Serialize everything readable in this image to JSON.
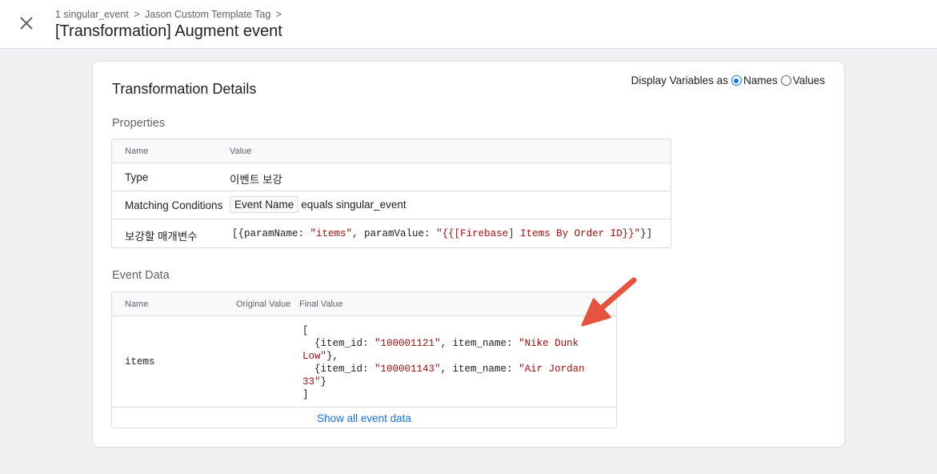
{
  "header": {
    "breadcrumb": [
      "1 singular_event",
      "Jason Custom Template Tag"
    ],
    "breadcrumb_separator": ">",
    "title": "[Transformation] Augment event"
  },
  "card": {
    "title": "Transformation Details",
    "display_vars": {
      "label": "Display Variables as",
      "options": [
        "Names",
        "Values"
      ],
      "selected": "Names"
    }
  },
  "properties": {
    "section_title": "Properties",
    "headers": {
      "name": "Name",
      "value": "Value"
    },
    "type": {
      "name": "Type",
      "value": "이벤트 보강"
    },
    "matching": {
      "name": "Matching Conditions",
      "chip": "Event Name",
      "rest": "equals singular_event"
    },
    "augment": {
      "name": "보강할 매개변수",
      "prefix": "[{paramName: ",
      "param_name": "\"items\"",
      "middle": ", paramValue: ",
      "param_value": "\"{{[Firebase] Items By Order ID}}\"",
      "suffix": "}]"
    }
  },
  "event_data": {
    "section_title": "Event Data",
    "headers": {
      "name": "Name",
      "original": "Original Value",
      "final": "Final Value"
    },
    "row": {
      "name": "items",
      "original": "",
      "line1": "[",
      "line2_a": "  {item_id: ",
      "line2_id": "\"100001121\"",
      "line2_b": ", item_name: ",
      "line2_name": "\"Nike Dunk",
      "line3_name": "Low\"",
      "line3_b": "},",
      "line4_a": "  {item_id: ",
      "line4_id": "\"100001143\"",
      "line4_b": ", item_name: ",
      "line4_name": "\"Air Jordan",
      "line5_name": "33\"",
      "line5_b": "}",
      "line6": "]"
    },
    "show_all": "Show all event data"
  },
  "colors": {
    "accent": "#1a73e8",
    "string": "#a50e0e",
    "arrow": "#e8533f"
  },
  "icons": {
    "close": "close-icon",
    "arrow": "annotation-arrow"
  }
}
